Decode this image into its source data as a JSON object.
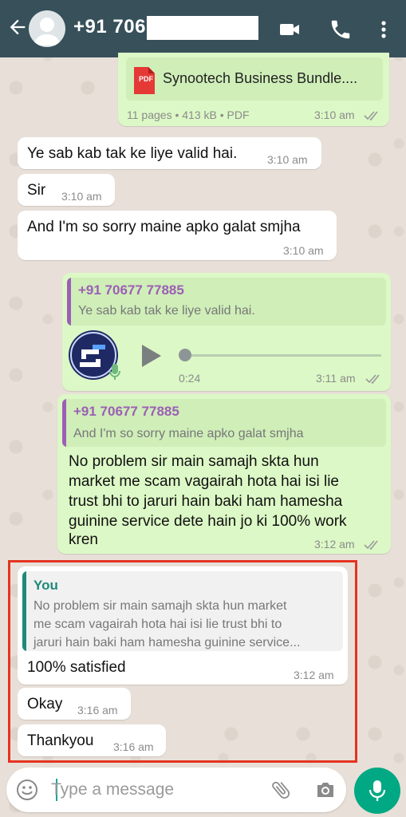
{
  "header": {
    "contact_name": "+91 7067",
    "icons": [
      "back-arrow-icon",
      "avatar",
      "video-call-icon",
      "phone-icon",
      "more-vert-icon"
    ]
  },
  "messages": {
    "pdf": {
      "badge": "PDF",
      "filename": "Synootech Business Bundle....",
      "meta": "11 pages • 413 kB • PDF",
      "time": "3:10 am"
    },
    "m1": {
      "text": "Ye sab kab tak ke liye valid hai.",
      "time": "3:10 am"
    },
    "m2": {
      "text": "Sir",
      "time": "3:10 am"
    },
    "m3": {
      "text": "And I'm so sorry maine apko galat smjha",
      "time": "3:10 am"
    },
    "voice": {
      "quote_name": "+91 70677 77885",
      "quote_text": "Ye sab kab tak ke liye valid hai.",
      "duration": "0:24",
      "time": "3:11 am"
    },
    "reply1": {
      "quote_name": "+91 70677 77885",
      "quote_text": "And I'm so sorry maine apko galat smjha",
      "lines": [
        "No problem sir main samajh skta hun",
        "market me scam vagairah hota hai isi lie",
        "trust bhi to jaruri hain baki ham hamesha",
        "guinine service dete hain jo ki 100% work",
        "kren"
      ],
      "time": "3:12 am"
    },
    "reply2": {
      "quote_name": "You",
      "quote_lines": [
        "No problem sir main samajh skta hun market",
        "me scam vagairah hota hai isi lie trust bhi to",
        "jaruri hain baki ham hamesha guinine service..."
      ],
      "text": "100% satisfied",
      "time": "3:12 am"
    },
    "m4": {
      "text": "Okay",
      "time": "3:16 am"
    },
    "m5": {
      "text": "Thankyou",
      "time": "3:16 am"
    }
  },
  "composer": {
    "placeholder": "Type a message",
    "icons": [
      "emoji-icon",
      "attach-icon",
      "camera-icon",
      "mic-icon"
    ]
  },
  "colors": {
    "header": "#37505a",
    "outgoing": "#dcf8c6",
    "incoming": "#ffffff",
    "accent": "#00a884",
    "highlight": "#e43321"
  }
}
